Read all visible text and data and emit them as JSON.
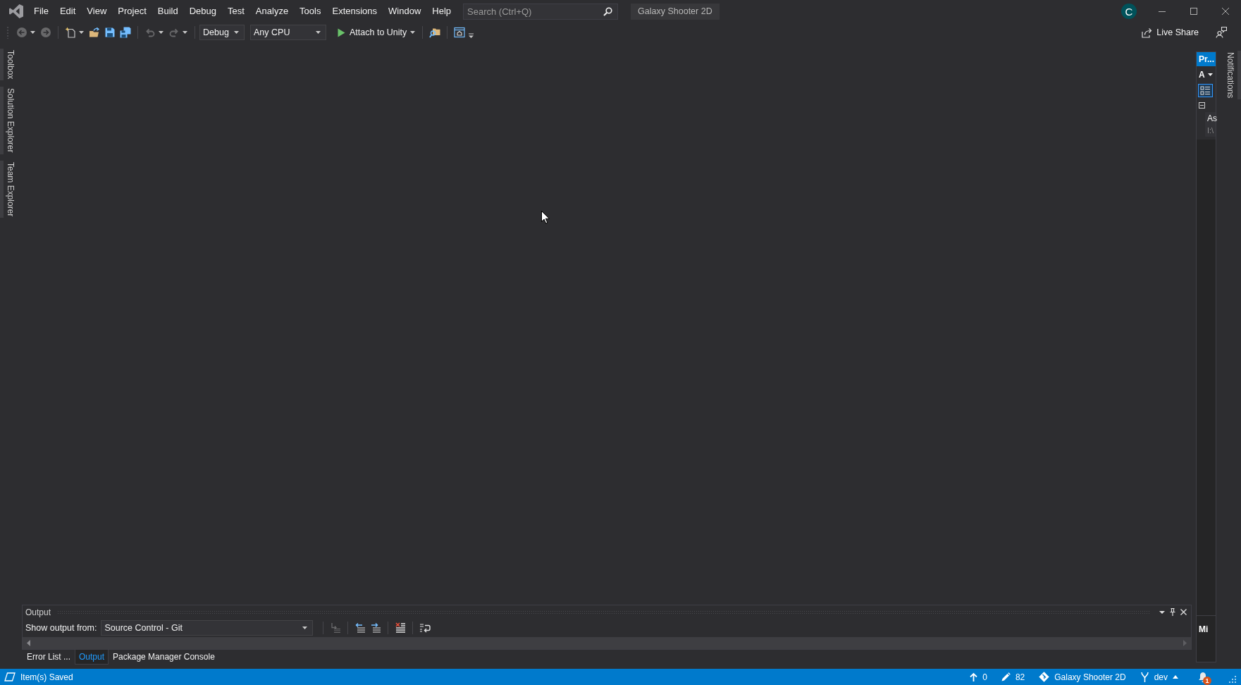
{
  "title_bar": {
    "menu": [
      "File",
      "Edit",
      "View",
      "Project",
      "Build",
      "Debug",
      "Test",
      "Analyze",
      "Tools",
      "Extensions",
      "Window",
      "Help"
    ],
    "search": {
      "placeholder": "Search (Ctrl+Q)"
    },
    "solution_name": "Galaxy Shooter 2D",
    "account_initial": "C"
  },
  "toolbar": {
    "items": [
      {
        "kind": "back",
        "disabled": true
      },
      {
        "kind": "forward",
        "disabled": true
      },
      {
        "kind": "separator"
      },
      {
        "kind": "new_project",
        "disabled": false
      },
      {
        "kind": "open",
        "disabled": false
      },
      {
        "kind": "save",
        "disabled": false
      },
      {
        "kind": "save_all",
        "disabled": false
      },
      {
        "kind": "separator"
      },
      {
        "kind": "undo",
        "disabled": true
      },
      {
        "kind": "redo",
        "disabled": true
      },
      {
        "kind": "separator"
      },
      {
        "kind": "configuration",
        "value": "Debug"
      },
      {
        "kind": "platform",
        "value": "Any CPU"
      },
      {
        "kind": "start",
        "label": "Attach to Unity"
      },
      {
        "kind": "separator"
      },
      {
        "kind": "find_in_files",
        "disabled": false
      },
      {
        "kind": "separator"
      },
      {
        "kind": "browser",
        "disabled": false
      },
      {
        "kind": "overflow"
      }
    ],
    "live_share": "Live Share"
  },
  "side_tabs": {
    "left": [
      "Toolbox",
      "Solution Explorer",
      "Team Explorer"
    ],
    "right": [
      "Notifications"
    ]
  },
  "properties_panel": {
    "title": "Pr...",
    "object": "A",
    "categorized_view": {
      "selected": true
    },
    "category": {
      "expanded": true,
      "rows": [
        {
          "name": "As",
          "value": "I:\\"
        }
      ]
    },
    "description": "Mi"
  },
  "output_panel": {
    "title": "Output",
    "source_label": "Show output from:",
    "source": "Source Control - Git",
    "tools": [
      {
        "kind": "separator"
      },
      {
        "kind": "find_message",
        "disabled": true
      },
      {
        "kind": "separator"
      },
      {
        "kind": "previous_message",
        "disabled": false
      },
      {
        "kind": "next_message",
        "disabled": false
      },
      {
        "kind": "separator"
      },
      {
        "kind": "clear_all",
        "disabled": false
      },
      {
        "kind": "separator"
      },
      {
        "kind": "word_wrap",
        "disabled": false
      }
    ],
    "tabs": [
      {
        "label": "Error List ...",
        "selected": false
      },
      {
        "label": "Output",
        "selected": true
      },
      {
        "label": "Package Manager Console",
        "selected": false
      }
    ]
  },
  "status_bar": {
    "message": "Item(s) Saved",
    "unpushed": "0",
    "changes": "82",
    "repository": "Galaxy Shooter 2D",
    "branch": "dev",
    "notifications": "1"
  }
}
